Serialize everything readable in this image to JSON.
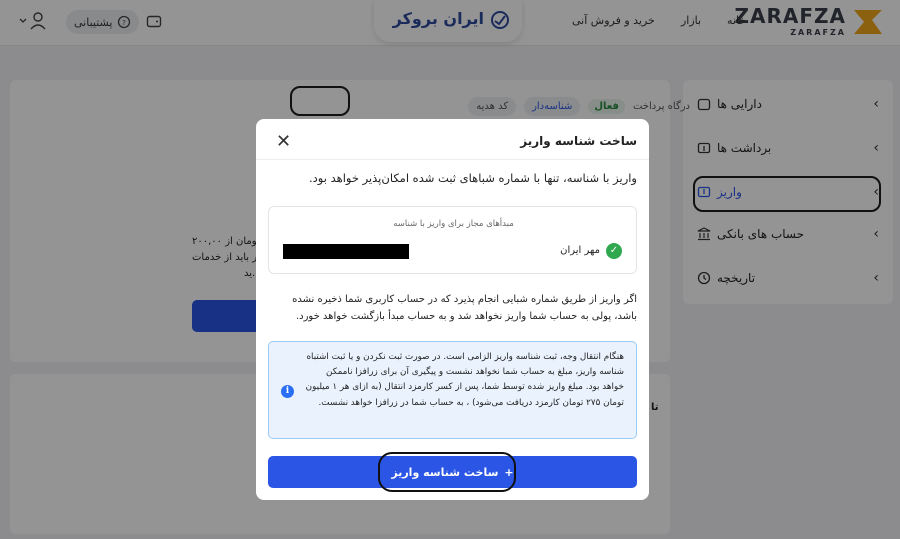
{
  "header": {
    "logo_word": "ZARAFZA",
    "logo_sub": "ZARAFZA",
    "nav": [
      "خانه",
      "بازار",
      "خرید و فروش آنی"
    ],
    "broker_brand": "ایران بروکر",
    "support_label": "پشتیبانی"
  },
  "sidebar": {
    "items": [
      {
        "label": "دارایی ها"
      },
      {
        "label": "برداشت ها"
      },
      {
        "label": "واریز"
      },
      {
        "label": "حساب های بانکی"
      },
      {
        "label": "تاریخچه"
      }
    ]
  },
  "tabs": {
    "gift": "کد هدیه",
    "id_based": "شناسه‌دار",
    "active_badge": "فعال",
    "gateway": "درگاه پرداخت"
  },
  "background": {
    "line1": "۲۰۰,۰۰ تومان از",
    "line2": "ر باید از خدمات",
    "line3": "ید.",
    "side_fragment": "تا"
  },
  "modal": {
    "title": "ساخت شناسه واریز",
    "subtitle": "واریز با شناسه، تنها با شماره شباهای ثبت شده امکان‌پذیر خواهد بود.",
    "source_label": "مبدأهای مجاز برای واریز با شناسه",
    "source_bank": "مهر ایران",
    "paragraph": "اگر واریز از طریق شماره شبایی انجام پذیرد که در حساب کاربری شما ذخیره نشده باشد، پولی به حساب شما واریز نخواهد شد و به حساب مبدأ بازگشت خواهد خورد.",
    "info_text": "هنگام انتقال وجه، ثبت شناسه واریز الزامی است. در صورت ثبت نکردن و یا ثبت اشتباه شناسه واریز، مبلغ به حساب شما نخواهد نشست و پیگیری آن برای زرافزا ناممکن خواهد بود. مبلغ واریز شده توسط شما، پس از کسر کارمزد انتقال (به ازای هر ۱ میلیون تومان ۲۷۵ تومان کارمزد دریافت می‌شود) ، به حساب شما در زرافزا خواهد نشست.",
    "button_label": "ساخت شناسه واریز",
    "colors": {
      "primary": "#2a55e5",
      "info_bg": "#eaf3fd",
      "info_border": "#9ccbf3",
      "success": "#2fa84f"
    }
  }
}
